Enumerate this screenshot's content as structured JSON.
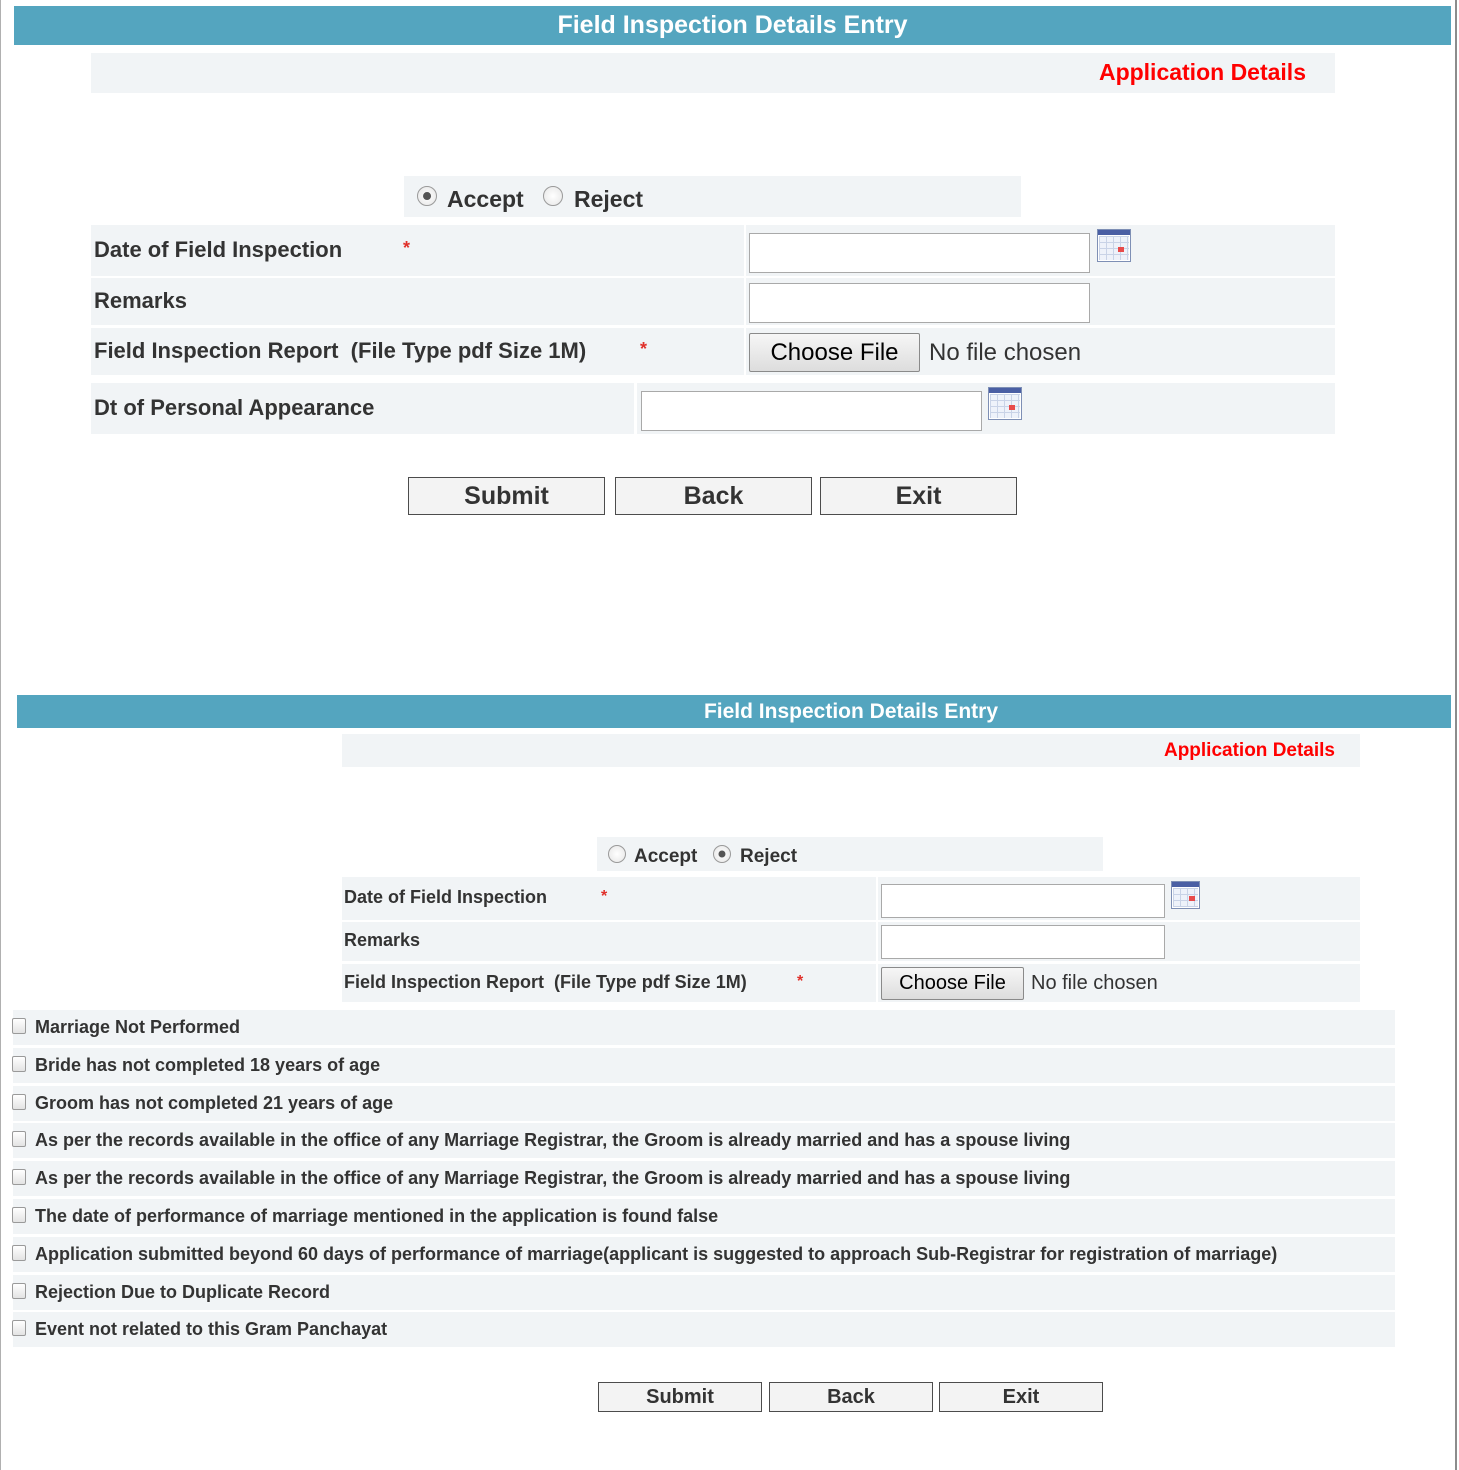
{
  "form1": {
    "title": "Field Inspection Details Entry",
    "app_details": "Application Details",
    "radio": {
      "accept": "Accept",
      "reject": "Reject",
      "selected": "accept"
    },
    "fields": {
      "date_label": "Date of Field Inspection",
      "date_value": "",
      "remarks_label": "Remarks",
      "remarks_value": "",
      "report_label": "Field Inspection Report  (File Type pdf Size 1M)",
      "required_mark": "*",
      "choose_file": "Choose File",
      "no_file": "No file chosen",
      "appearance_label": "Dt of Personal Appearance",
      "appearance_value": ""
    },
    "buttons": {
      "submit": "Submit",
      "back": "Back",
      "exit": "Exit"
    }
  },
  "form2": {
    "title": "Field Inspection Details Entry",
    "app_details": "Application Details",
    "radio": {
      "accept": "Accept",
      "reject": "Reject",
      "selected": "reject"
    },
    "fields": {
      "date_label": "Date of Field Inspection",
      "date_value": "",
      "remarks_label": "Remarks",
      "remarks_value": "",
      "report_label": "Field Inspection Report  (File Type pdf Size 1M)",
      "required_mark": "*",
      "choose_file": "Choose File",
      "no_file": "No file chosen"
    },
    "reasons": [
      {
        "label": "Marriage Not Performed",
        "checked": false
      },
      {
        "label": "Bride has not completed 18 years of age",
        "checked": false
      },
      {
        "label": "Groom has not completed 21 years of age",
        "checked": false
      },
      {
        "label": "As per the records available in the office of any Marriage Registrar, the Groom is already married and has a spouse living",
        "checked": false
      },
      {
        "label": "As per the records available in the office of any Marriage Registrar, the Groom is already married and has a spouse living",
        "checked": false
      },
      {
        "label": "The date of performance of marriage mentioned in the application is found false",
        "checked": false
      },
      {
        "label": "Application submitted beyond 60 days of performance of marriage(applicant is suggested to approach Sub-Registrar for registration of marriage)",
        "checked": false
      },
      {
        "label": "Rejection Due to Duplicate Record",
        "checked": false
      },
      {
        "label": "Event not related to this Gram Panchayat",
        "checked": false
      }
    ],
    "buttons": {
      "submit": "Submit",
      "back": "Back",
      "exit": "Exit"
    }
  },
  "icons": {
    "calendar": "calendar-icon"
  },
  "colors": {
    "title_bar": "#54a5bf",
    "application_details": "#ff0000",
    "required": "#e0302a",
    "row_shade": "#f1f4f6"
  }
}
